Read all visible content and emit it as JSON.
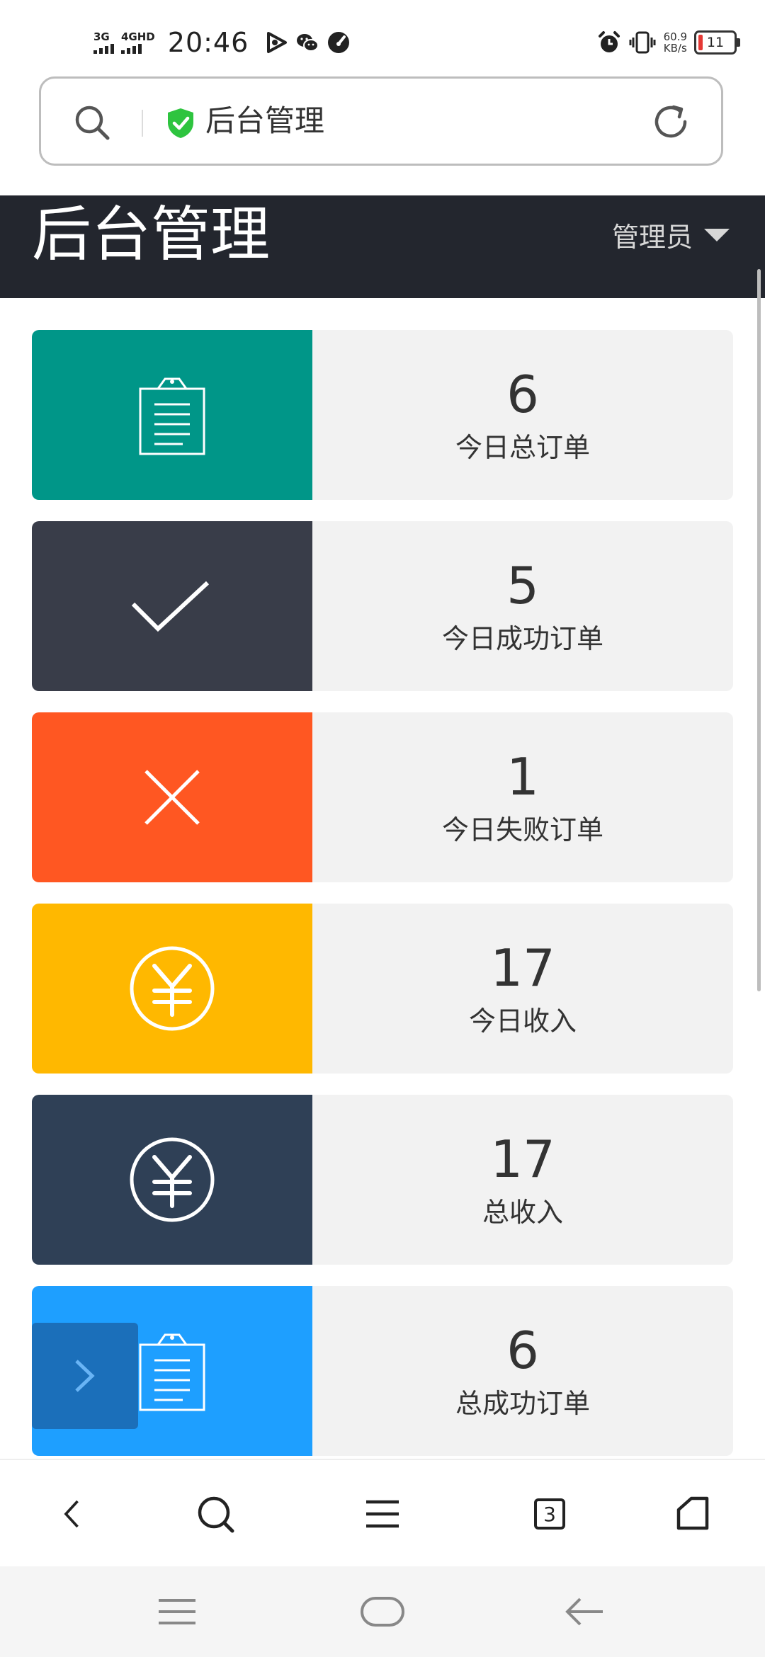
{
  "status_bar": {
    "network_1": "3G",
    "network_2": "4GHD",
    "time": "20:46",
    "speed_value": "60.9",
    "speed_unit": "KB/s",
    "battery": "11"
  },
  "address_bar": {
    "title": "后台管理"
  },
  "header": {
    "title": "后台管理",
    "user_menu": "管理员"
  },
  "stats": [
    {
      "value": "6",
      "label": "今日总订单",
      "color": "#009688",
      "icon": "clipboard-icon"
    },
    {
      "value": "5",
      "label": "今日成功订单",
      "color": "#393d49",
      "icon": "checkmark-icon"
    },
    {
      "value": "1",
      "label": "今日失败订单",
      "color": "#ff5722",
      "icon": "close-icon"
    },
    {
      "value": "17",
      "label": "今日收入",
      "color": "#ffb800",
      "icon": "yen-icon"
    },
    {
      "value": "17",
      "label": "总收入",
      "color": "#2f4056",
      "icon": "yen-icon"
    },
    {
      "value": "6",
      "label": "总成功订单",
      "color": "#1e9fff",
      "icon": "clipboard-icon"
    }
  ],
  "bottom_bar": {
    "tab_count": "3"
  }
}
